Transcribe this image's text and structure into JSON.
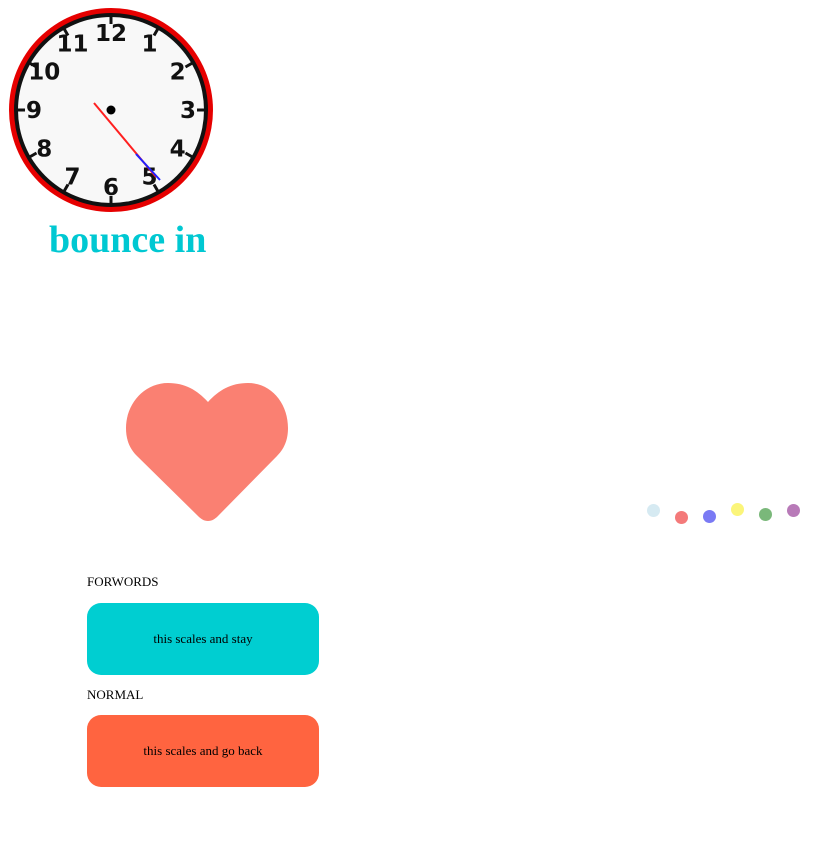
{
  "colors": {
    "clock_rim": "#e60000",
    "clock_bezel": "#111111",
    "clock_face": "#f8f8f8",
    "hour_hand": "#ff2020",
    "minute_hand": "#2020ff",
    "headline": "#00c8d2",
    "heart": "#fa8072",
    "forwards_box": "#00ced1",
    "normal_box": "#ff6440"
  },
  "clock": {
    "numerals": [
      "12",
      "1",
      "2",
      "3",
      "4",
      "5",
      "6",
      "7",
      "8",
      "9",
      "10",
      "11"
    ],
    "icon": "analog-clock-icon"
  },
  "headline": {
    "text": "bounce in"
  },
  "heart": {
    "icon": "heart-icon"
  },
  "loader": {
    "icon": "bouncing-dots-loader",
    "dot_colors": [
      "#d6eaf2",
      "#f47a7a",
      "#7a7af4",
      "#fbf57a",
      "#7ab87a",
      "#b87ab8"
    ]
  },
  "demos": {
    "forwards": {
      "label": "FORWORDS",
      "box_text": "this scales and stay"
    },
    "normal": {
      "label": "NORMAL",
      "box_text": "this scales and go back"
    }
  }
}
